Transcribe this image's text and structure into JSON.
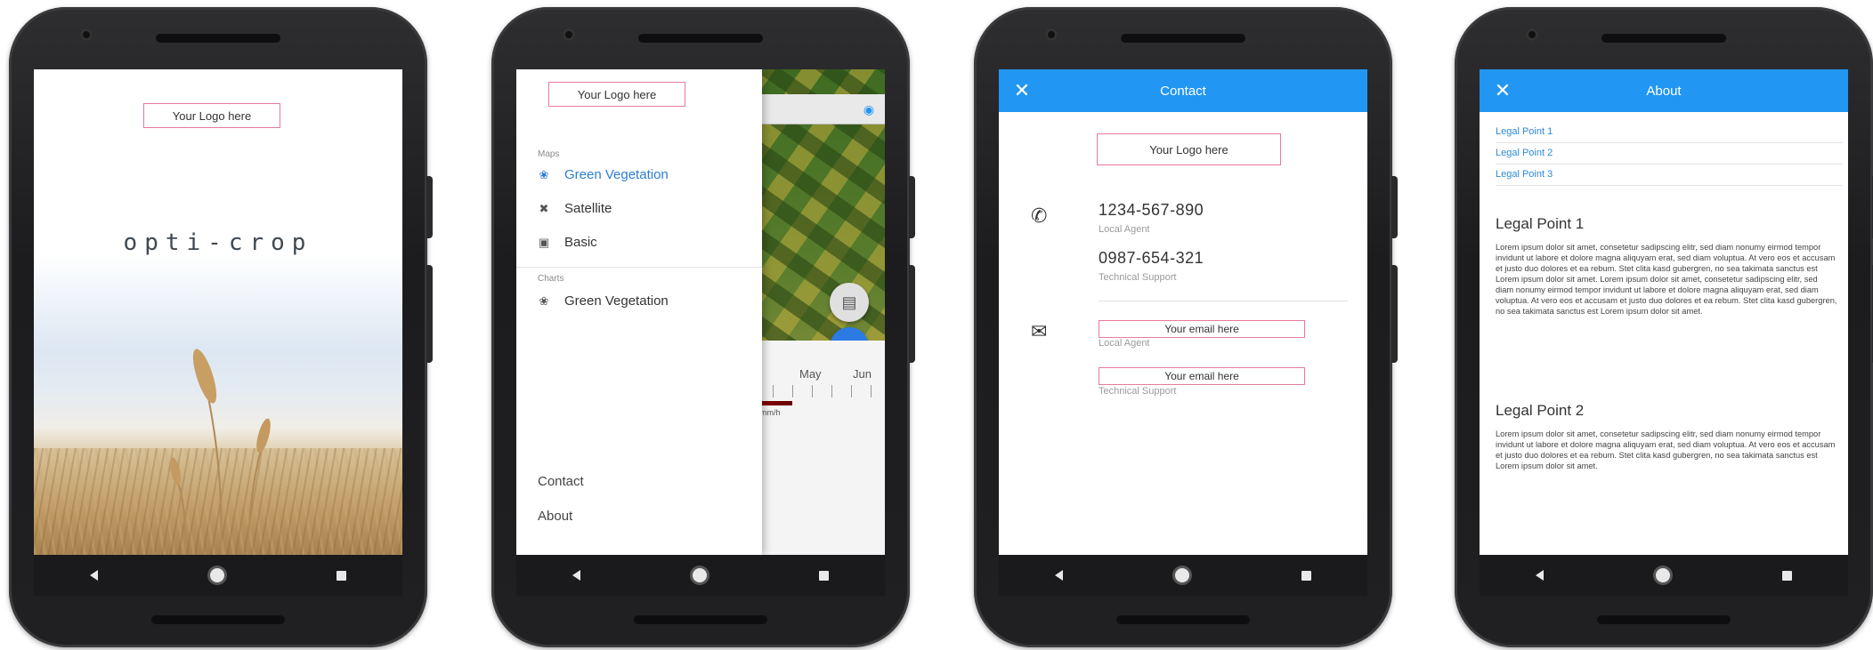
{
  "splash": {
    "logo_placeholder": "Your Logo here",
    "app_name": "opti-crop"
  },
  "drawer": {
    "logo_placeholder": "Your Logo here",
    "sections": [
      {
        "title": "Maps",
        "items": [
          {
            "label": "Green Vegetation",
            "icon": "plant-icon",
            "active": true
          },
          {
            "label": "Satellite",
            "icon": "satellite-icon",
            "active": false
          },
          {
            "label": "Basic",
            "icon": "map-icon",
            "active": false
          }
        ]
      },
      {
        "title": "Charts",
        "items": [
          {
            "label": "Green Vegetation",
            "icon": "plant-icon",
            "active": false
          }
        ]
      }
    ],
    "footer": [
      "Contact",
      "About"
    ],
    "timeline": {
      "months": [
        "May",
        "Jun"
      ],
      "scale_labels": "0.2  0.5  0.8  mm/h"
    },
    "accent_color": "#2e7dd1"
  },
  "contact": {
    "title": "Contact",
    "logo_placeholder": "Your Logo here",
    "phones": [
      {
        "number": "1234-567-890",
        "role": "Local Agent"
      },
      {
        "number": "0987-654-321",
        "role": "Technical Support"
      }
    ],
    "emails": [
      {
        "placeholder": "Your email here",
        "role": "Local Agent"
      },
      {
        "placeholder": "Your email here",
        "role": "Technical Support"
      }
    ],
    "appbar_color": "#2196f3"
  },
  "about": {
    "title": "About",
    "links": [
      "Legal Point 1",
      "Legal Point 2",
      "Legal Point 3"
    ],
    "sections": [
      {
        "heading": "Legal Point 1",
        "body": "Lorem ipsum dolor sit amet, consetetur sadipscing elitr, sed diam nonumy eirmod tempor invidunt ut labore et dolore magna aliquyam erat, sed diam voluptua. At vero eos et accusam et justo duo dolores et ea rebum. Stet clita kasd gubergren, no sea takimata sanctus est Lorem ipsum dolor sit amet. Lorem ipsum dolor sit amet, consetetur sadipscing elitr, sed diam nonumy eirmod tempor invidunt ut labore et dolore magna aliquyam erat, sed diam voluptua. At vero eos et accusam et justo duo dolores et ea rebum. Stet clita kasd gubergren, no sea takimata sanctus est Lorem ipsum dolor sit amet."
      },
      {
        "heading": "Legal Point 2",
        "body": "Lorem ipsum dolor sit amet, consetetur sadipscing elitr, sed diam nonumy eirmod tempor invidunt ut labore et dolore magna aliquyam erat, sed diam voluptua. At vero eos et accusam et justo duo dolores et ea rebum. Stet clita kasd gubergren, no sea takimata sanctus est Lorem ipsum dolor sit amet."
      }
    ]
  }
}
